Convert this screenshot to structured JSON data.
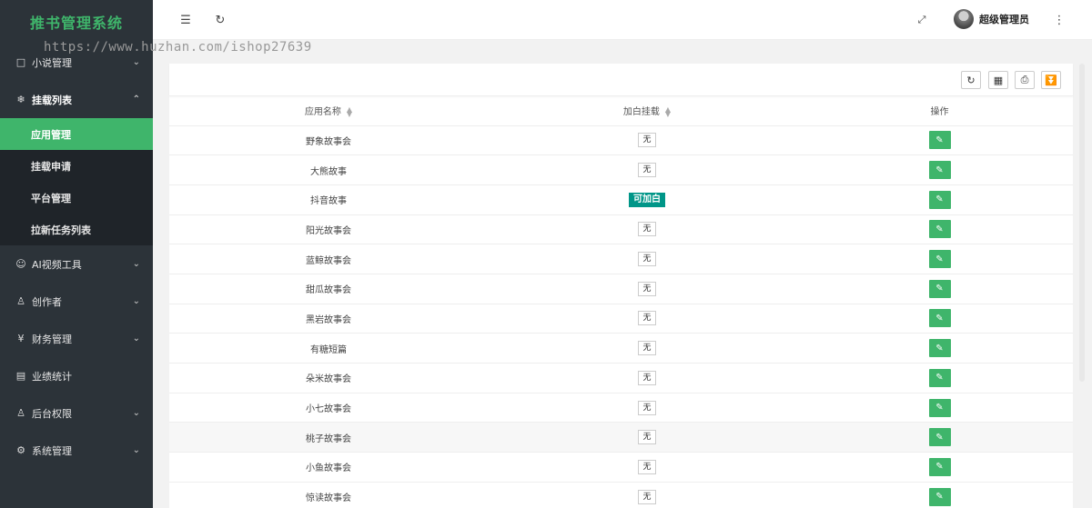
{
  "app": {
    "title": "推书管理系统",
    "watermark": "https://www.huzhan.com/ishop27639"
  },
  "sidebar": {
    "items": [
      {
        "label": "小说管理"
      },
      {
        "label": "挂载列表",
        "sub": [
          {
            "label": "应用管理",
            "active": true
          },
          {
            "label": "挂载申请"
          },
          {
            "label": "平台管理"
          },
          {
            "label": "拉新任务列表"
          }
        ]
      },
      {
        "label": "AI视频工具"
      },
      {
        "label": "创作者"
      },
      {
        "label": "财务管理"
      },
      {
        "label": "业绩统计"
      },
      {
        "label": "后台权限"
      },
      {
        "label": "系统管理"
      }
    ]
  },
  "header": {
    "user_name": "超级管理员"
  },
  "table": {
    "columns": [
      "应用名称",
      "加白挂载",
      "操作"
    ],
    "rows": [
      {
        "name": "野象故事会",
        "whitelist": "无"
      },
      {
        "name": "大熊故事",
        "whitelist": "无"
      },
      {
        "name": "抖音故事",
        "whitelist": "可加白"
      },
      {
        "name": "阳光故事会",
        "whitelist": "无"
      },
      {
        "name": "蓝鲸故事会",
        "whitelist": "无"
      },
      {
        "name": "甜瓜故事会",
        "whitelist": "无"
      },
      {
        "name": "黑岩故事会",
        "whitelist": "无"
      },
      {
        "name": "有糖短篇",
        "whitelist": "无"
      },
      {
        "name": "朵米故事会",
        "whitelist": "无"
      },
      {
        "name": "小七故事会",
        "whitelist": "无"
      },
      {
        "name": "桃子故事会",
        "whitelist": "无"
      },
      {
        "name": "小鱼故事会",
        "whitelist": "无"
      },
      {
        "name": "惊读故事会",
        "whitelist": "无"
      }
    ]
  },
  "colors": {
    "accent": "#3fb56b",
    "sidebar_bg": "#2c3339",
    "tag_green": "#009688"
  }
}
